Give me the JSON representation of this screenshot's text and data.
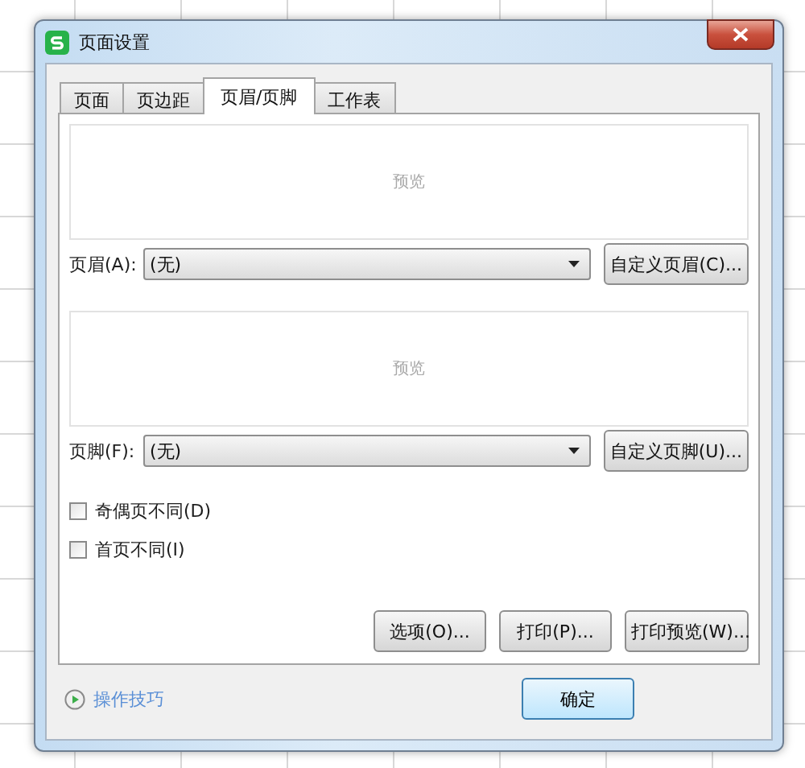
{
  "window": {
    "title": "页面设置"
  },
  "tabs": [
    {
      "label": "页面",
      "selected": false
    },
    {
      "label": "页边距",
      "selected": false
    },
    {
      "label": "页眉/页脚",
      "selected": true
    },
    {
      "label": "工作表",
      "selected": false
    }
  ],
  "header": {
    "preview": "预览",
    "label": "页眉(A):",
    "value": "(无)",
    "button": "自定义页眉(C)..."
  },
  "footer": {
    "preview": "预览",
    "label": "页脚(F):",
    "value": "(无)",
    "button": "自定义页脚(U)..."
  },
  "options": [
    {
      "label": "奇偶页不同(D)",
      "checked": false
    },
    {
      "label": "首页不同(I)",
      "checked": false
    }
  ],
  "panel_buttons": [
    "选项(O)...",
    "打印(P)...",
    "打印预览(W)..."
  ],
  "tips_link": "操作技巧",
  "dialog_buttons": [
    "确定"
  ]
}
